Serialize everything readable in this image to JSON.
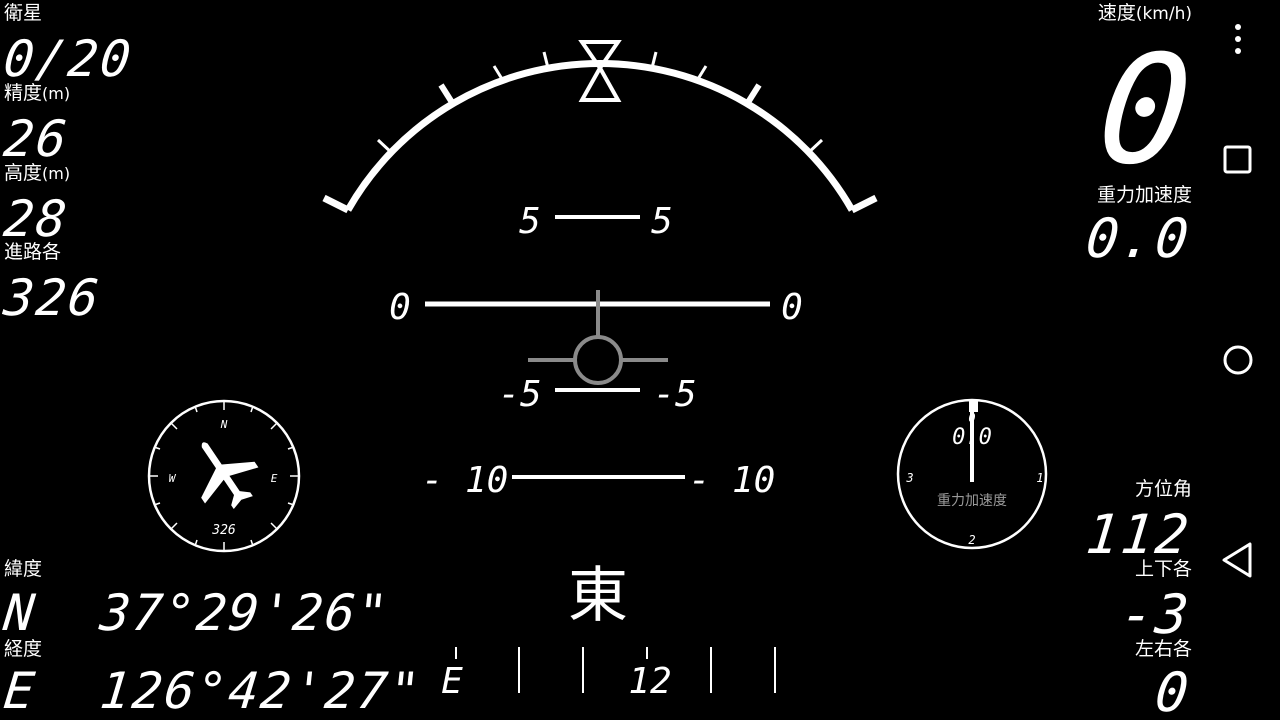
{
  "left": {
    "satellites": {
      "label": "衛星",
      "value": "0/20"
    },
    "accuracy": {
      "label": "精度",
      "unit": "(m)",
      "value": "26"
    },
    "altitude": {
      "label": "高度",
      "unit": "(m)",
      "value": "28"
    },
    "course": {
      "label": "進路各",
      "value": "326"
    },
    "latitude": {
      "label": "緯度",
      "value": "N  37°29'26\""
    },
    "longitude": {
      "label": "経度",
      "value": "E  126°42'27\""
    }
  },
  "right": {
    "speed": {
      "label": "速度",
      "unit": "(km/h)",
      "value": "0"
    },
    "gforce": {
      "label": "重力加速度",
      "value": "0.0"
    },
    "azimuth": {
      "label": "方位角",
      "value": "112"
    },
    "pitch": {
      "label": "上下各",
      "value": "-3"
    },
    "roll": {
      "label": "左右各",
      "value": "0"
    }
  },
  "attitude": {
    "ladder": [
      {
        "left": "5",
        "right": "5"
      },
      {
        "left": "0",
        "right": "0"
      },
      {
        "left": "-5",
        "right": "-5"
      },
      {
        "left": "- 10",
        "right": "- 10"
      }
    ]
  },
  "heading": {
    "direction": "東",
    "tape_left": "E",
    "tape_mid": "12"
  },
  "compass": {
    "n": "N",
    "e": "E",
    "w": "W",
    "heading": "326",
    "icon": "airplane-icon"
  },
  "gauge": {
    "top": "0",
    "right": "1",
    "bottom": "2",
    "left": "3",
    "value": "0.0",
    "label": "重力加速度"
  },
  "nav": {
    "menu_icon": "overflow-menu-icon",
    "recent_icon": "recent-apps-icon",
    "home_icon": "home-icon",
    "back_icon": "back-icon"
  }
}
